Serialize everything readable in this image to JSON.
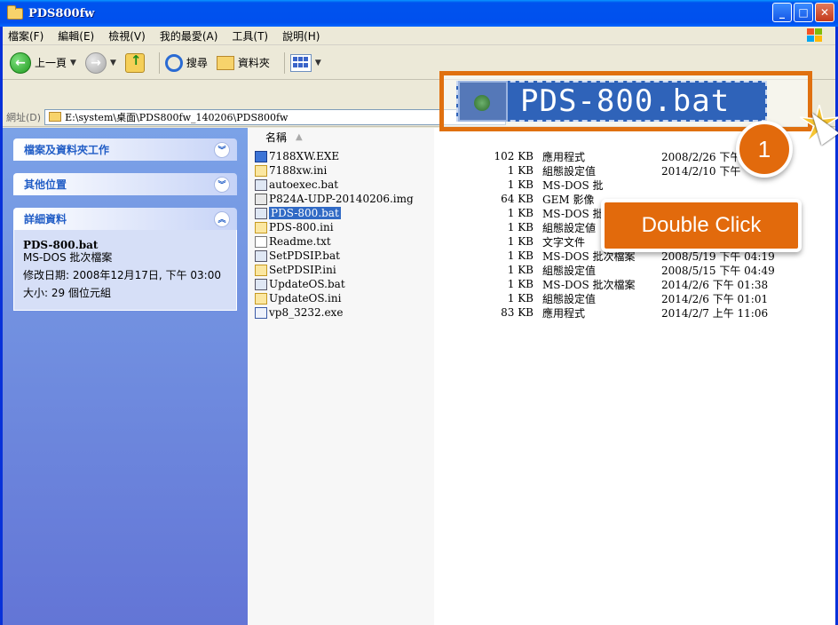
{
  "window": {
    "title": "PDS800fw"
  },
  "menu": {
    "items": [
      "檔案(F)",
      "編輯(E)",
      "檢視(V)",
      "我的最愛(A)",
      "工具(T)",
      "說明(H)"
    ]
  },
  "toolbar": {
    "back_label": "上一頁",
    "search_label": "搜尋",
    "folders_label": "資料夾"
  },
  "address": {
    "label": "網址(D)",
    "path": "E:\\system\\桌面\\PDS800fw_140206\\PDS800fw"
  },
  "taskpane": {
    "panel1_title": "檔案及資料夾工作",
    "panel2_title": "其他位置",
    "panel3_title": "詳細資料",
    "details": {
      "name": "PDS-800.bat",
      "type": "MS-DOS 批次檔案",
      "modified": "修改日期: 2008年12月17日, 下午 03:00",
      "size": "大小: 29 個位元組"
    }
  },
  "filelist": {
    "col_name": "名稱",
    "files": [
      {
        "name": "7188XW.EXE",
        "size": "102 KB",
        "type": "應用程式",
        "date": "2008/2/26 下午",
        "icon": "exe"
      },
      {
        "name": "7188xw.ini",
        "size": "1 KB",
        "type": "組態設定值",
        "date": "2014/2/10 下午",
        "icon": "ini"
      },
      {
        "name": "autoexec.bat",
        "size": "1 KB",
        "type": "MS-DOS 批",
        "date": "",
        "icon": "bat"
      },
      {
        "name": "P824A-UDP-20140206.img",
        "size": "64 KB",
        "type": "GEM 影像",
        "date": "",
        "icon": "img"
      },
      {
        "name": "PDS-800.bat",
        "size": "1 KB",
        "type": "MS-DOS 批",
        "date": "",
        "icon": "bat",
        "selected": true
      },
      {
        "name": "PDS-800.ini",
        "size": "1 KB",
        "type": "組態設定値",
        "date": "",
        "icon": "ini"
      },
      {
        "name": "Readme.txt",
        "size": "1 KB",
        "type": "文字文件",
        "date": "",
        "icon": "txt"
      },
      {
        "name": "SetPDSIP.bat",
        "size": "1 KB",
        "type": "MS-DOS 批次檔案",
        "date": "2008/5/19 下午 04:19",
        "icon": "bat"
      },
      {
        "name": "SetPDSIP.ini",
        "size": "1 KB",
        "type": "組態設定值",
        "date": "2008/5/15 下午 04:49",
        "icon": "ini"
      },
      {
        "name": "UpdateOS.bat",
        "size": "1 KB",
        "type": "MS-DOS 批次檔案",
        "date": "2014/2/6 下午 01:38",
        "icon": "bat"
      },
      {
        "name": "UpdateOS.ini",
        "size": "1 KB",
        "type": "組態設定值",
        "date": "2014/2/6 下午 01:01",
        "icon": "ini"
      },
      {
        "name": "vp8_3232.exe",
        "size": "83 KB",
        "type": "應用程式",
        "date": "2014/2/7 上午 11:06",
        "icon": "exe2"
      }
    ]
  },
  "callout": {
    "filename": "PDS-800.bat",
    "step_number": "1",
    "instruction": "Double Click",
    "accent_color": "#e26a0c"
  }
}
